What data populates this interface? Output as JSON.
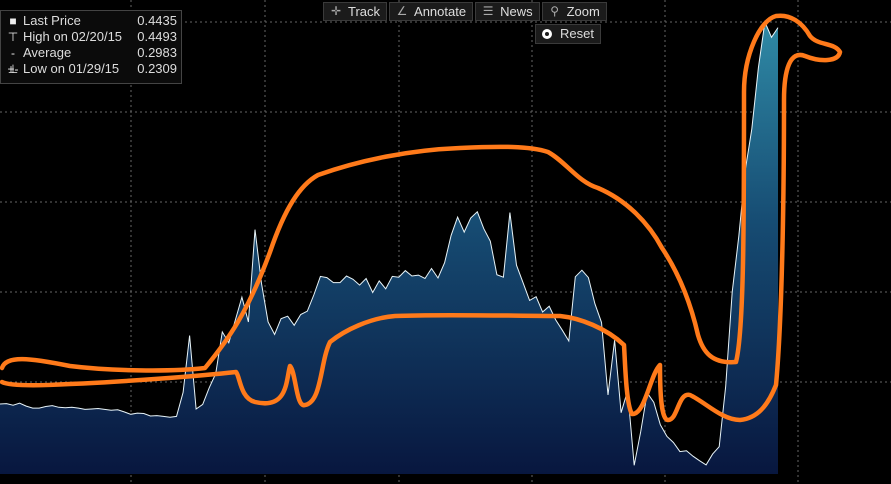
{
  "toolbar": {
    "items": [
      {
        "label": "Track",
        "icon": "crosshair-icon"
      },
      {
        "label": "Annotate",
        "icon": "pencil-icon"
      },
      {
        "label": "News",
        "icon": "news-icon"
      },
      {
        "label": "Zoom",
        "icon": "magnifier-icon"
      }
    ],
    "reset_label": "Reset"
  },
  "legend": {
    "rows": [
      {
        "label": "Last Price",
        "value": "0.4435"
      },
      {
        "label": "High on 02/20/15",
        "value": "0.4493"
      },
      {
        "label": "Average",
        "value": "0.2983"
      },
      {
        "label": "Low on 01/29/15",
        "value": "0.2309"
      }
    ]
  },
  "colors": {
    "background": "#000000",
    "line": "#e8f4f8",
    "area_top": "#2b7f9a",
    "area_bottom": "#0a1a4a",
    "annotation": "#ff7a1a",
    "grid": "#666666"
  },
  "chart_data": {
    "type": "area",
    "title": "",
    "xlabel": "",
    "ylabel": "",
    "ylim": [
      0.228,
      0.452
    ],
    "grid": true,
    "legend_position": "top-left",
    "series": [
      {
        "name": "Last Price",
        "values": [
          0.2618,
          0.262,
          0.2612,
          0.2622,
          0.2608,
          0.2598,
          0.2598,
          0.2606,
          0.261,
          0.2602,
          0.26,
          0.2602,
          0.2598,
          0.2592,
          0.2594,
          0.2596,
          0.2592,
          0.2588,
          0.259,
          0.258,
          0.2568,
          0.2574,
          0.2572,
          0.256,
          0.2562,
          0.2558,
          0.2554,
          0.2558,
          0.2674,
          0.2948,
          0.2594,
          0.2616,
          0.2696,
          0.2764,
          0.2966,
          0.2914,
          0.3024,
          0.3134,
          0.3014,
          0.346,
          0.32,
          0.3014,
          0.2954,
          0.303,
          0.3042,
          0.2998,
          0.305,
          0.3066,
          0.3144,
          0.3234,
          0.3228,
          0.3204,
          0.3204,
          0.3236,
          0.322,
          0.3192,
          0.3224,
          0.3156,
          0.3212,
          0.3174,
          0.3234,
          0.323,
          0.3262,
          0.3236,
          0.324,
          0.3224,
          0.3272,
          0.3226,
          0.33,
          0.3432,
          0.352,
          0.3448,
          0.3516,
          0.3546,
          0.3464,
          0.3404,
          0.3242,
          0.323,
          0.3542,
          0.3288,
          0.3204,
          0.3118,
          0.3136,
          0.3062,
          0.309,
          0.3024,
          0.2974,
          0.2922,
          0.3232,
          0.3264,
          0.3228,
          0.3102,
          0.3012,
          0.2662,
          0.2926,
          0.2576,
          0.2682,
          0.2322,
          0.2484,
          0.2672,
          0.2626,
          0.2518,
          0.2462,
          0.2432,
          0.2388,
          0.2392,
          0.2366,
          0.2344,
          0.2324,
          0.2376,
          0.2412,
          0.2704,
          0.3158,
          0.3428,
          0.3748,
          0.3946,
          0.4242,
          0.4462,
          0.4388,
          0.4435
        ]
      }
    ],
    "annotation": "hand-drawn dinosaur outline"
  }
}
